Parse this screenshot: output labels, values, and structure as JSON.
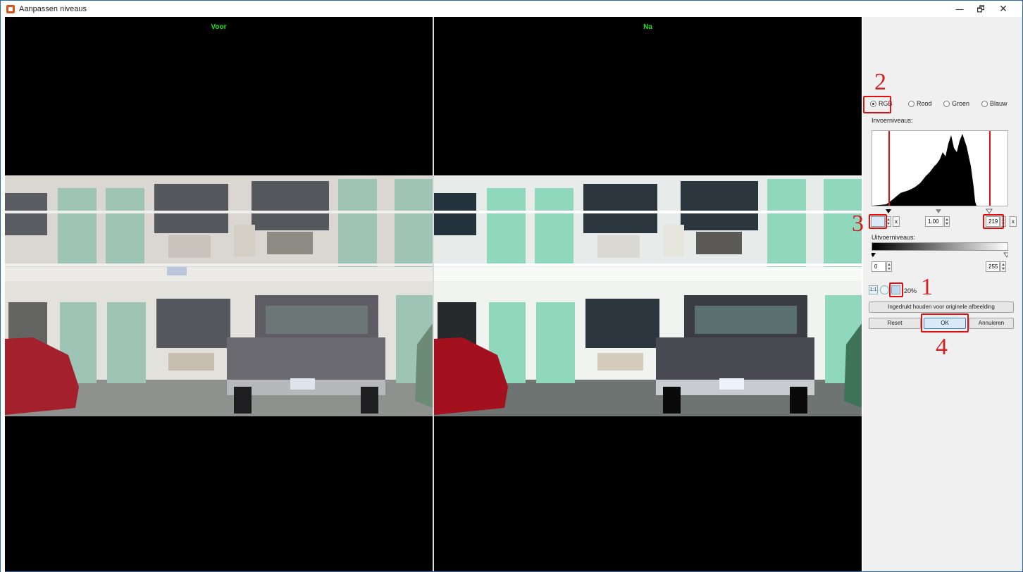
{
  "window": {
    "title": "Aanpassen niveaus",
    "minimize": "—",
    "maximize": "🗗",
    "close": "✕"
  },
  "preview": {
    "before_label": "Voor",
    "after_label": "Na"
  },
  "panel": {
    "channels": [
      "RGB",
      "Rood",
      "Groen",
      "Blauw"
    ],
    "selected_channel": "RGB",
    "input_levels_label": "Invoerniveaus:",
    "input_black": "",
    "input_gamma": "1.00",
    "input_white": "219",
    "output_levels_label": "Uitvoerniveaus:",
    "output_black": "0",
    "output_white": "255",
    "clear_label": "x",
    "zoom_percent": "20%",
    "zoom_icons": [
      "1:1",
      "fit-icon",
      "zoom-icon"
    ],
    "hold_button": "Ingedrukt houden voor originele afbeelding",
    "reset_button": "Reset",
    "ok_button": "OK",
    "cancel_button": "Annuleren"
  },
  "annotations": [
    "1",
    "2",
    "3",
    "4"
  ],
  "colors": {
    "label_green": "#19e619",
    "annotation_red": "#e01010",
    "border_blue": "#2b6cb0"
  }
}
